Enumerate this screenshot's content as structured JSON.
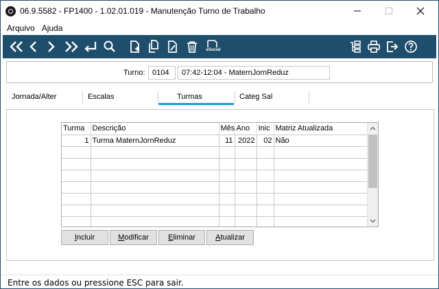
{
  "window": {
    "title": "06.9.5582 - FP1400 - 1.02.01.019 - Manutenção Turno de Trabalho"
  },
  "menu": {
    "items": [
      {
        "label": "Arquivo"
      },
      {
        "label": "Ajuda"
      }
    ]
  },
  "toolbar": {
    "esocial_label": "eSocial"
  },
  "turno": {
    "label": "Turno:",
    "code": "0104",
    "description": "07:42-12:04 - MaternJornReduz"
  },
  "tabs": [
    {
      "label": "Jornada/Alter"
    },
    {
      "label": "Escalas"
    },
    {
      "label": "Turmas",
      "active": true
    },
    {
      "label": "Categ Sal"
    }
  ],
  "grid": {
    "columns": [
      "Turma",
      "Descrição",
      "Mês",
      "Ano",
      "Inic",
      "Matriz Atualizada"
    ],
    "rows": [
      {
        "turma": "1",
        "descricao": "Turma MaternJornReduz",
        "mes": "11",
        "ano": "2022",
        "inic": "02",
        "matriz": "Não"
      }
    ]
  },
  "actions": {
    "incluir": {
      "accel": "I",
      "rest": "ncluir"
    },
    "modificar": {
      "accel": "M",
      "rest": "odificar"
    },
    "eliminar": {
      "accel": "E",
      "rest": "liminar"
    },
    "atualizar": {
      "accel": "A",
      "rest": "tualizar"
    }
  },
  "status": {
    "message": "Entre os dados ou pressione ESC para sair."
  },
  "colors": {
    "toolbar_bg": "#1e4e6b",
    "tab_active": "#1a9ad6"
  }
}
